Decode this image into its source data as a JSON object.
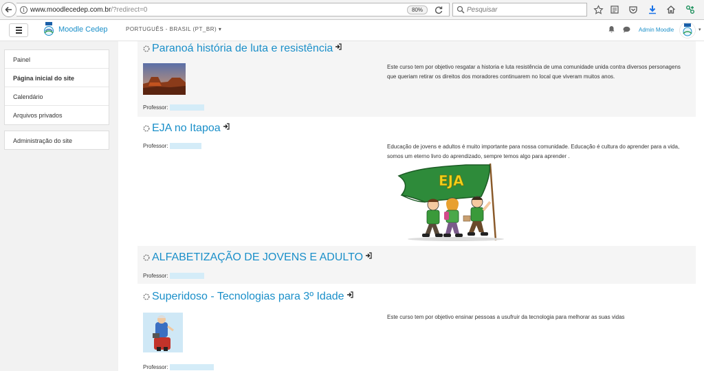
{
  "browser": {
    "url_host": "www.moodlecedep.com.br",
    "url_path": "/?redirect=0",
    "zoom": "80%",
    "search_placeholder": "Pesquisar"
  },
  "navbar": {
    "site_name": "Moodle Cedep",
    "language": "PORTUGUÊS - BRASIL (PT_BR)",
    "user_name": "Admin Moodle"
  },
  "sidebar": {
    "items": [
      {
        "label": "Painel"
      },
      {
        "label": "Página inicial do site"
      },
      {
        "label": "Calendário"
      },
      {
        "label": "Arquivos privados"
      }
    ],
    "admin_label": "Administração do site"
  },
  "courses": [
    {
      "name": "Paranoá história de luta e resistência",
      "summary": "Este curso tem por objetivo resgatar a historia e luta resistência de uma comunidade unida contra diversos personagens que queriam retirar os direitos dos moradores continuarem no local que viveram muitos anos.",
      "teacher_label": "Professor:"
    },
    {
      "name": "EJA no Itapoa",
      "summary": "Educação de jovens e adultos é muito importante para nossa comunidade. Educação é cultura do aprender para a vida, somos um eterno livro do aprendizado, sempre temos algo para aprender .",
      "teacher_label": "Professor:",
      "flag_text": "EJA"
    },
    {
      "name": "ALFABETIZAÇÃO DE JOVENS E ADULTO",
      "teacher_label": "Professor:"
    },
    {
      "name": "Superidoso - Tecnologias para 3º Idade",
      "summary": "Este curso tem por objetivo ensinar pessoas a usufruir da tecnologia para melhorar as suas vidas",
      "teacher_label": "Professor:"
    }
  ],
  "colors": {
    "link_blue": "#1a8fc9",
    "course_bg": "#f5f5f5",
    "sidebar_bg": "#f2f2f2"
  }
}
